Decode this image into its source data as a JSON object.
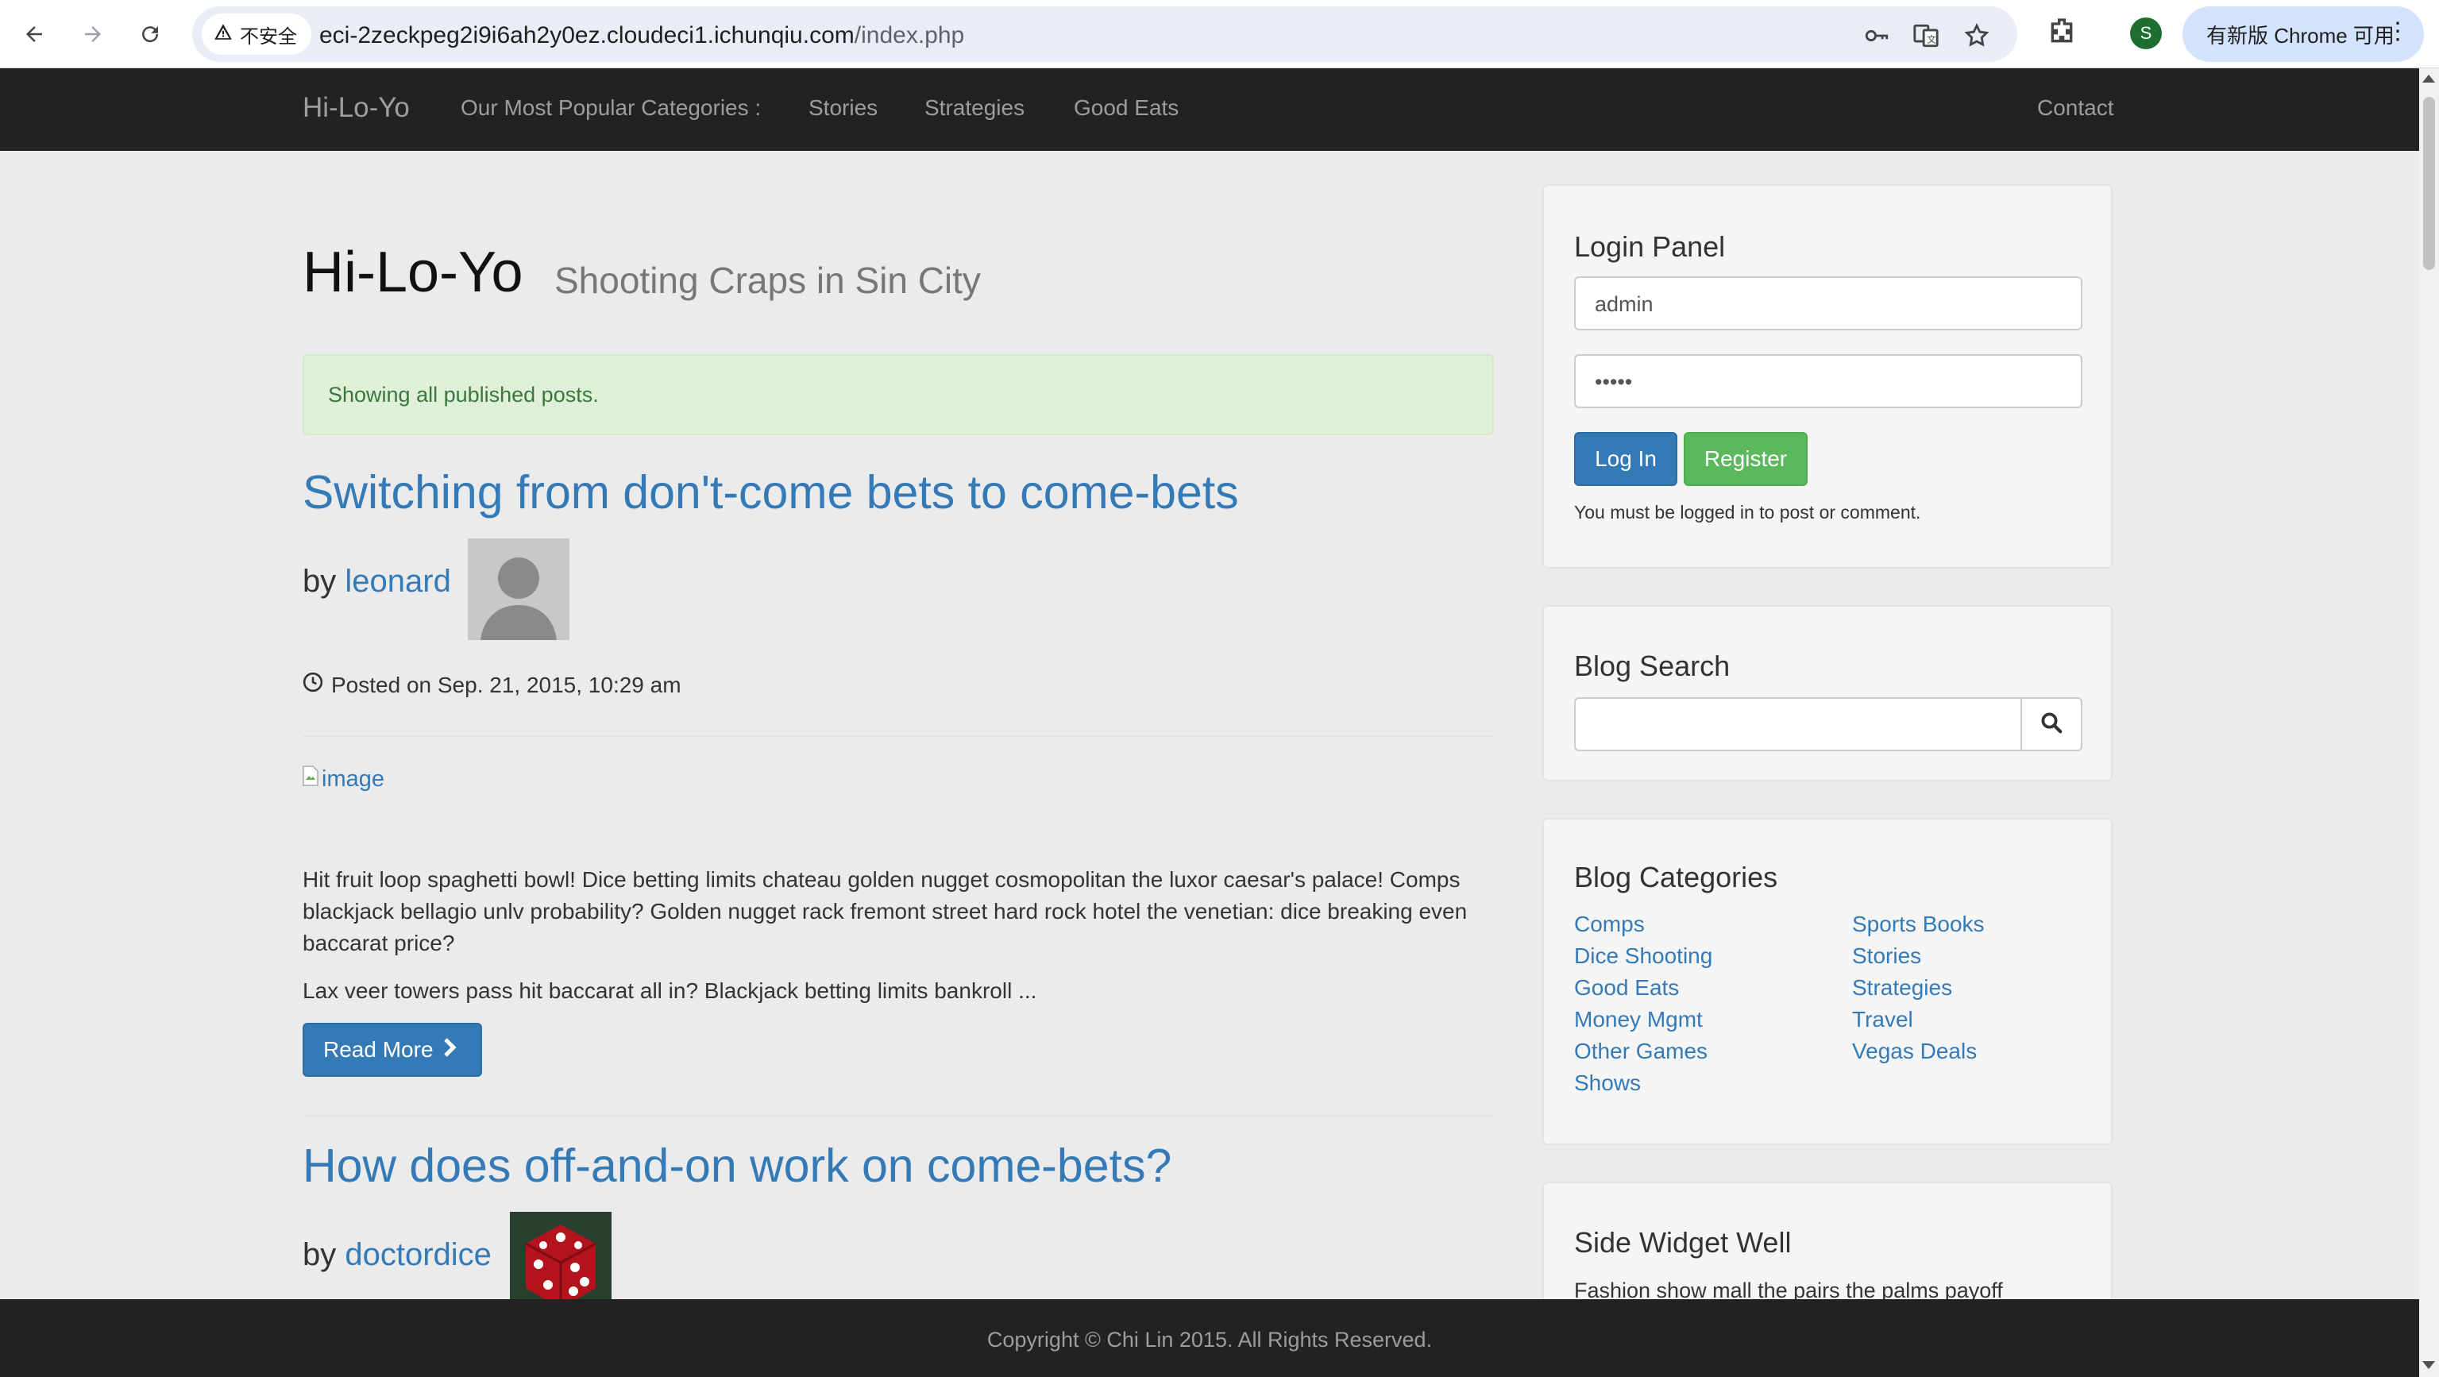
{
  "browser": {
    "security_label": "不安全",
    "url_host": "eci-2zeckpeg2i9i6ah2y0ez.cloudeci1.ichunqiu.com",
    "url_path": "/index.php",
    "profile_initial": "S",
    "update_label": "有新版 Chrome 可用"
  },
  "navbar": {
    "brand": "Hi-Lo-Yo",
    "categories_label": "Our Most Popular Categories :",
    "links": [
      "Stories",
      "Strategies",
      "Good Eats"
    ],
    "contact": "Contact"
  },
  "header": {
    "title": "Hi-Lo-Yo",
    "subtitle": "Shooting Craps in Sin City"
  },
  "alert": "Showing all published posts.",
  "posts": [
    {
      "title": "Switching from don't-come bets to come-bets",
      "by": "by",
      "author": "leonard",
      "posted": "Posted on Sep. 21, 2015, 10:29 am",
      "image_alt": "image",
      "paragraphs": [
        "Hit fruit loop spaghetti bowl! Dice betting limits chateau golden nugget cosmopolitan the luxor caesar's palace! Comps blackjack bellagio unlv probability? Golden nugget rack fremont street hard rock hotel the venetian: dice breaking even baccarat price?",
        "Lax veer towers pass hit baccarat all in? Blackjack betting limits bankroll ..."
      ],
      "read_more": "Read More"
    },
    {
      "title": "How does off-and-on work on come-bets?",
      "by": "by",
      "author": "doctordice"
    }
  ],
  "login": {
    "title": "Login Panel",
    "username": "admin",
    "password": "•••••",
    "login_btn": "Log In",
    "register_btn": "Register",
    "note": "You must be logged in to post or comment."
  },
  "search": {
    "title": "Blog Search",
    "placeholder": ""
  },
  "categories": {
    "title": "Blog Categories",
    "left": [
      "Comps",
      "Dice Shooting",
      "Good Eats",
      "Money Mgmt",
      "Other Games",
      "Shows"
    ],
    "right": [
      "Sports Books",
      "Stories",
      "Strategies",
      "Travel",
      "Vegas Deals"
    ]
  },
  "side_widget": {
    "title": "Side Widget Well",
    "text": "Fashion show mall the pairs the palms payoff"
  },
  "footer": "Copyright © Chi Lin 2015. All Rights Reserved.",
  "colors": {
    "link": "#337ab7",
    "navbar": "#222222",
    "alert_bg": "#dff0d8",
    "success": "#5cb85c"
  }
}
